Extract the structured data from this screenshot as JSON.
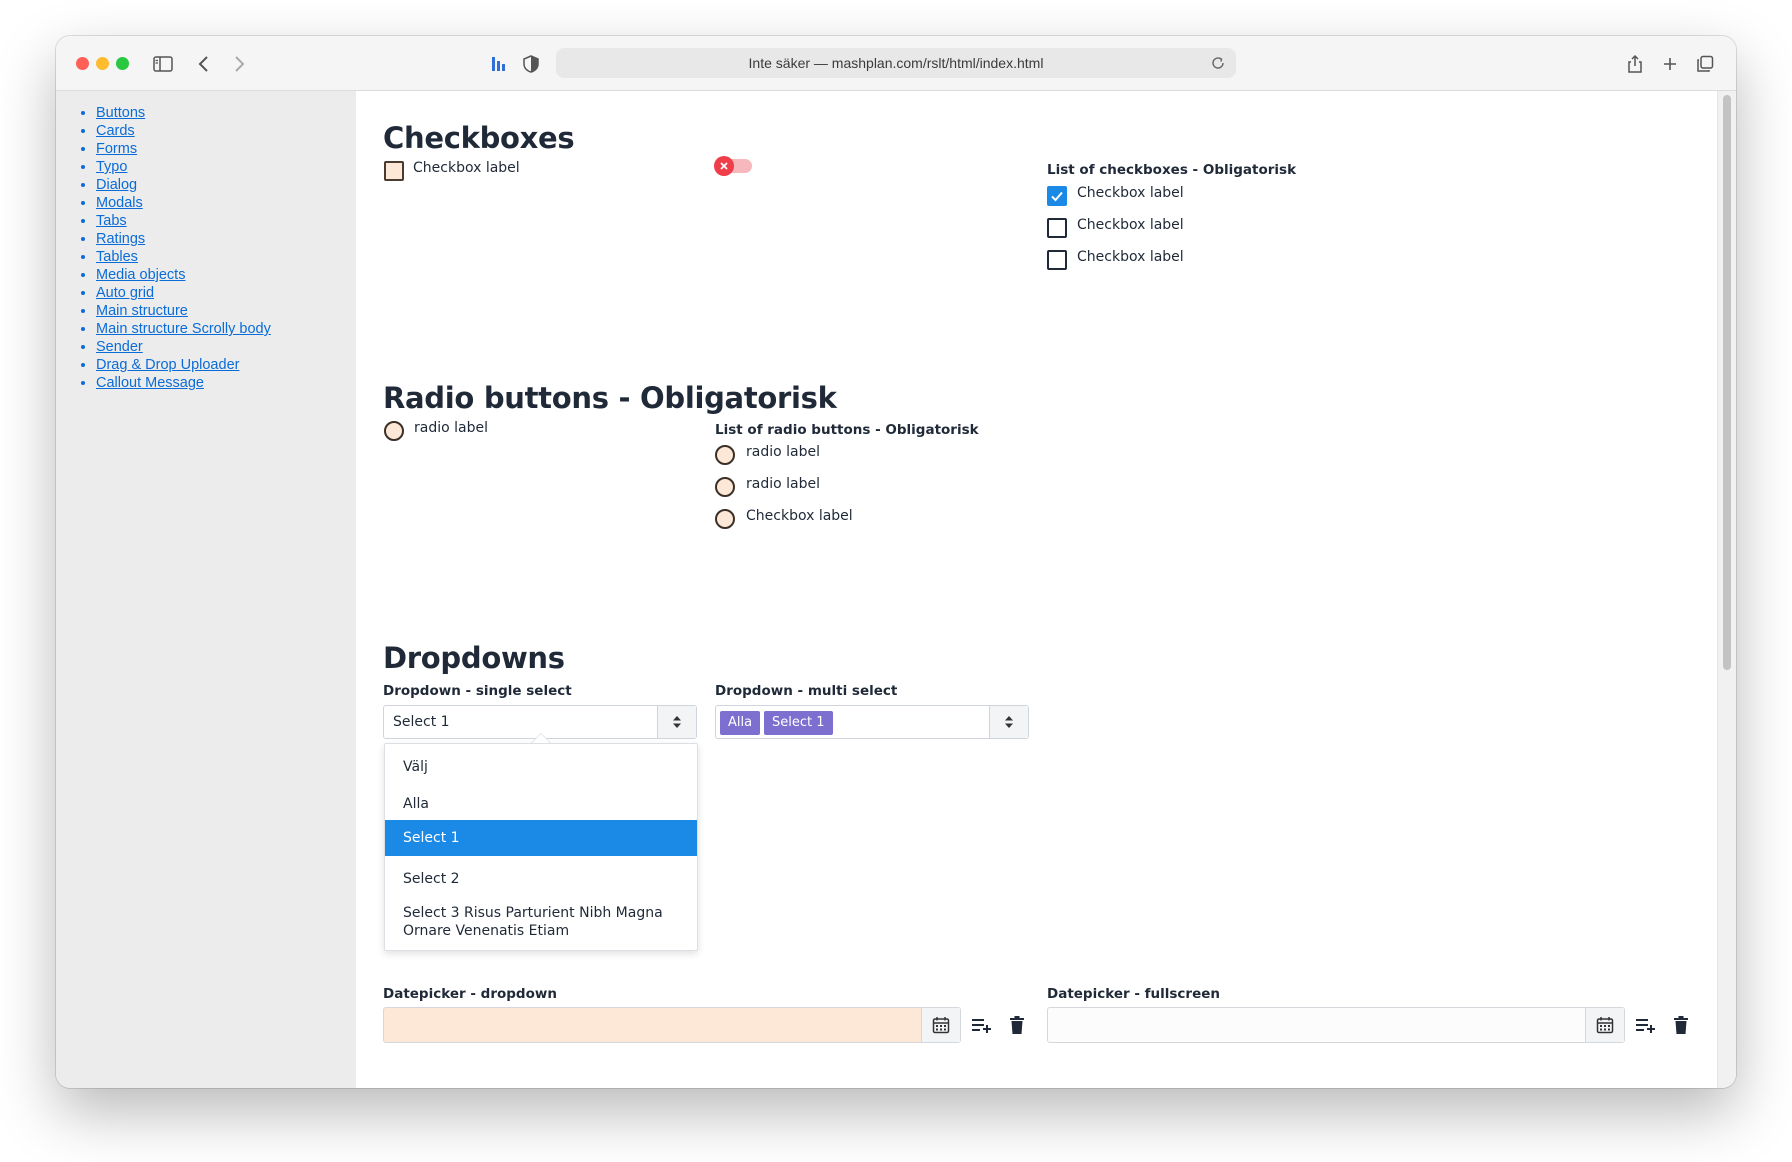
{
  "browser": {
    "address": "Inte säker — mashplan.com/rslt/html/index.html"
  },
  "sidebar": {
    "items": [
      {
        "label": "Buttons"
      },
      {
        "label": "Cards"
      },
      {
        "label": "Forms"
      },
      {
        "label": "Typo"
      },
      {
        "label": "Dialog"
      },
      {
        "label": "Modals"
      },
      {
        "label": "Tabs"
      },
      {
        "label": "Ratings"
      },
      {
        "label": "Tables"
      },
      {
        "label": "Media objects"
      },
      {
        "label": "Auto grid"
      },
      {
        "label": "Main structure"
      },
      {
        "label": "Main structure Scrolly body"
      },
      {
        "label": "Sender"
      },
      {
        "label": "Drag & Drop Uploader"
      },
      {
        "label": "Callout Message"
      }
    ]
  },
  "checkboxes": {
    "title": "Checkboxes",
    "single_label": "Checkbox label",
    "list_title": "List of checkboxes - Obligatorisk",
    "list": [
      {
        "label": "Checkbox label",
        "checked": true
      },
      {
        "label": "Checkbox label",
        "checked": false
      },
      {
        "label": "Checkbox label",
        "checked": false
      }
    ]
  },
  "radios": {
    "title": "Radio buttons - Obligatorisk",
    "single_label": "radio label",
    "list_title": "List of radio buttons - Obligatorisk",
    "list": [
      {
        "label": "radio label"
      },
      {
        "label": "radio label"
      },
      {
        "label": "Checkbox label"
      }
    ]
  },
  "dropdowns": {
    "title": "Dropdowns",
    "single": {
      "label": "Dropdown - single select",
      "value": "Select 1",
      "options": [
        {
          "label": "Välj"
        },
        {
          "label": "Alla"
        },
        {
          "label": "Select 1",
          "selected": true
        },
        {
          "label": "Select 2"
        },
        {
          "label": "Select 3 Risus Parturient Nibh Magna Ornare Venenatis Etiam"
        }
      ]
    },
    "multi": {
      "label": "Dropdown - multi select",
      "chips": [
        "Alla",
        "Select 1"
      ]
    }
  },
  "datepickers": {
    "dropdown_label": "Datepicker - dropdown",
    "fullscreen_label": "Datepicker - fullscreen"
  },
  "colors": {
    "link": "#0a6cd8",
    "accent": "#1a8ae6",
    "chip": "#7c6fd0",
    "warn_bg": "#fde7d6",
    "toggle_off": "#ef3e4a"
  }
}
